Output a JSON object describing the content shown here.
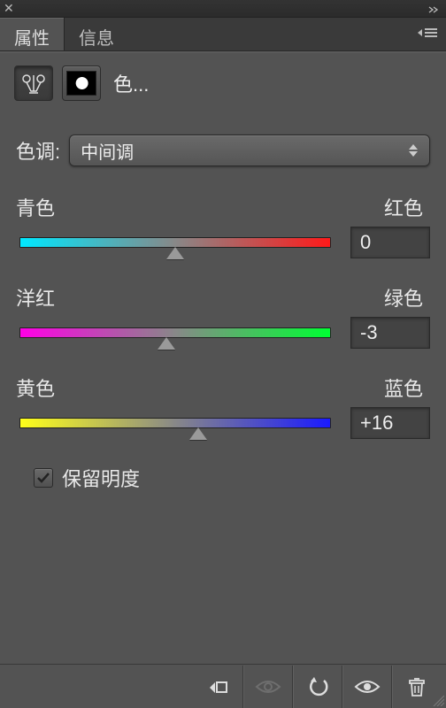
{
  "tabs": {
    "properties": "属性",
    "info": "信息"
  },
  "adjustment": {
    "title": "色..."
  },
  "tone": {
    "label": "色调:",
    "selected": "中间调"
  },
  "sliders": {
    "cr": {
      "left": "青色",
      "right": "红色",
      "value": "0",
      "pos": 50
    },
    "mg": {
      "left": "洋红",
      "right": "绿色",
      "value": "-3",
      "pos": 47
    },
    "yb": {
      "left": "黄色",
      "right": "蓝色",
      "value": "+16",
      "pos": 57.5
    }
  },
  "preserve": {
    "label": "保留明度",
    "checked": true
  }
}
